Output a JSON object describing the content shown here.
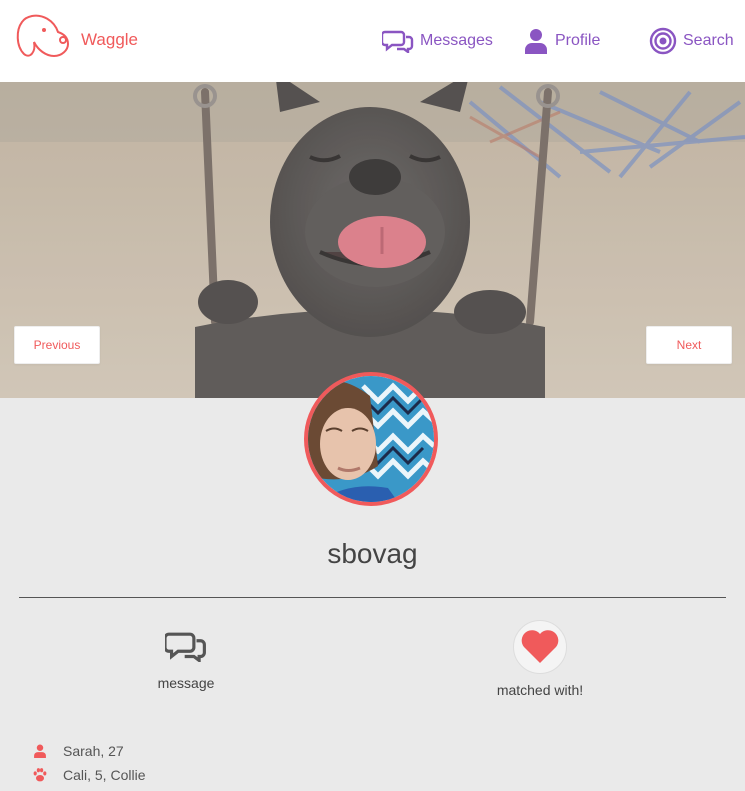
{
  "header": {
    "brand": "Waggle",
    "nav": [
      {
        "label": "Messages",
        "icon": "chat-bubbles-icon"
      },
      {
        "label": "Profile",
        "icon": "person-icon"
      },
      {
        "label": "Search",
        "icon": "target-icon"
      }
    ]
  },
  "hero": {
    "previous_label": "Previous",
    "next_label": "Next"
  },
  "profile": {
    "username": "sbovag",
    "actions": {
      "message_label": "message",
      "match_label": "matched with!"
    },
    "details": {
      "owner": "Sarah, 27",
      "dog": "Cali, 5, Collie"
    }
  },
  "colors": {
    "accent": "#f05a5b",
    "nav": "#8a55c2",
    "background": "#eaeaea"
  }
}
